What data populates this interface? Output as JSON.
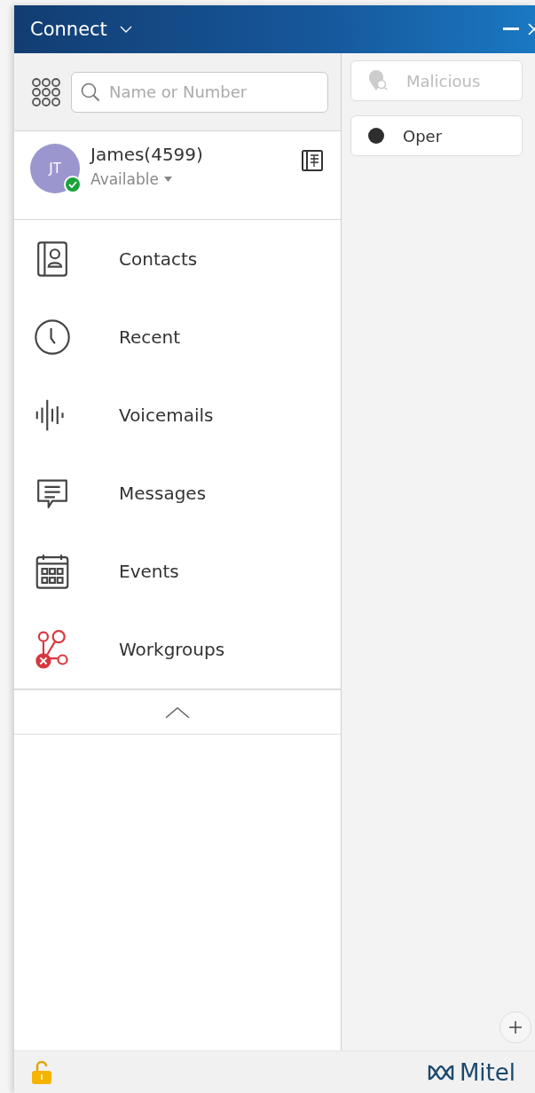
{
  "window": {
    "title": "Connect"
  },
  "search": {
    "placeholder": "Name or Number"
  },
  "profile": {
    "initials": "JT",
    "name": "James(4599)",
    "status": "Available"
  },
  "nav": [
    {
      "kind": "contacts",
      "label": "Contacts"
    },
    {
      "kind": "recent",
      "label": "Recent"
    },
    {
      "kind": "voicemails",
      "label": "Voicemails"
    },
    {
      "kind": "messages",
      "label": "Messages"
    },
    {
      "kind": "events",
      "label": "Events"
    },
    {
      "kind": "workgroups",
      "label": "Workgroups"
    }
  ],
  "actions": [
    {
      "kind": "malicious",
      "label": "Malicious",
      "disabled": true
    },
    {
      "kind": "oper",
      "label": "Oper",
      "disabled": false
    }
  ],
  "footer": {
    "brand": "Mitel"
  }
}
